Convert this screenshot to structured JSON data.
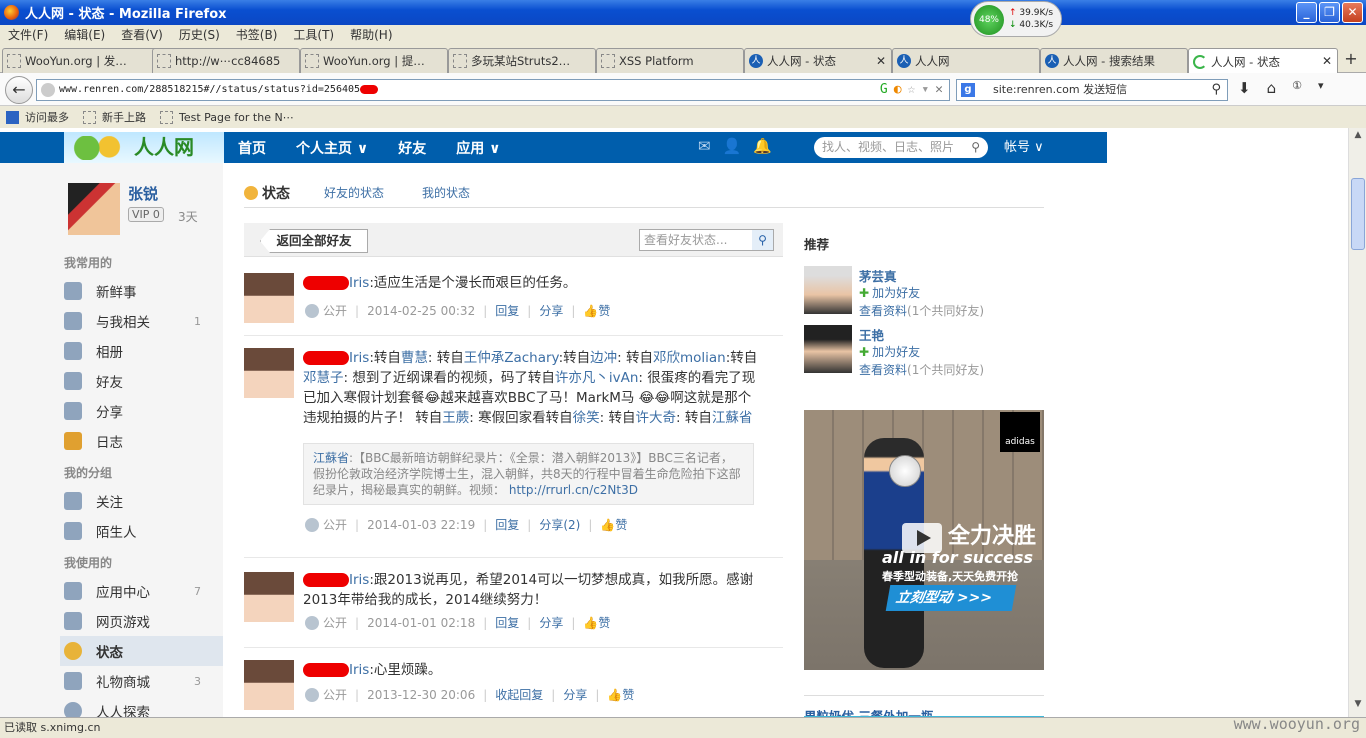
{
  "window": {
    "title": "人人网 - 状态 - Mozilla Firefox"
  },
  "netmon": {
    "percent": "48%",
    "up": "39.9K/s",
    "down": "40.3K/s"
  },
  "menu": [
    "文件(F)",
    "编辑(E)",
    "查看(V)",
    "历史(S)",
    "书签(B)",
    "工具(T)",
    "帮助(H)"
  ],
  "tabs": [
    {
      "label": "WooYun.org | 发…"
    },
    {
      "label": "http://w⋯cc84685"
    },
    {
      "label": "WooYun.org | 提…"
    },
    {
      "label": "多玩某站Struts2…"
    },
    {
      "label": "XSS Platform"
    },
    {
      "label": "人人网 - 状态"
    },
    {
      "label": "人人网"
    },
    {
      "label": "人人网 - 搜索结果"
    },
    {
      "label": "人人网 - 状态"
    }
  ],
  "url": "www.renren.com/288518215#//status/status?id=256405",
  "search": {
    "value": "site:renren.com 发送短信"
  },
  "bookmarks": [
    "访问最多",
    "新手上路",
    "Test Page for the N⋯"
  ],
  "site": {
    "logo": "人人网",
    "nav": [
      "首页",
      "个人主页 ∨",
      "好友",
      "应用 ∨"
    ],
    "search_placeholder": "找人、视频、日志、照片",
    "account": "帐号 ∨"
  },
  "profile": {
    "name": "张锐",
    "vip": "VIP 0",
    "days": "3天"
  },
  "left": {
    "common_title": "我常用的",
    "common": [
      {
        "label": "新鲜事",
        "count": ""
      },
      {
        "label": "与我相关",
        "count": "1"
      },
      {
        "label": "相册",
        "count": ""
      },
      {
        "label": "好友",
        "count": ""
      },
      {
        "label": "分享",
        "count": ""
      },
      {
        "label": "日志",
        "count": ""
      }
    ],
    "groups_title": "我的分组",
    "groups": [
      {
        "label": "关注"
      },
      {
        "label": "陌生人"
      }
    ],
    "used_title": "我使用的",
    "used": [
      {
        "label": "应用中心",
        "count": "7"
      },
      {
        "label": "网页游戏",
        "count": ""
      },
      {
        "label": "状态",
        "count": ""
      },
      {
        "label": "礼物商城",
        "count": "3"
      },
      {
        "label": "人人探索",
        "count": ""
      }
    ]
  },
  "main": {
    "tab_current": "状态",
    "tab_friends": "好友的状态",
    "tab_mine": "我的状态",
    "back_button": "返回全部好友",
    "feed_search_placeholder": "查看好友状态...",
    "public": "公开",
    "reply": "回复",
    "share": "分享",
    "like": "赞",
    "posts": [
      {
        "prefix": "Iris",
        "text": ":适应生活是个漫长而艰巨的任务。",
        "time": "2014-02-25 00:32"
      },
      {
        "prefix": "Iris",
        "text_a": ":转自",
        "l1": "曹慧",
        "text_b": ": 转自",
        "l2": "王仲承Zachary",
        "text_c": ":转自",
        "l3": "边冲",
        "text_d": ": 转自",
        "l4": "邓欣molian",
        "text_e": ":转自",
        "l5": "邓慧子",
        "text_f": ": 想到了近纲课看的视频，码了转自",
        "l6": "许亦凡丶ivAn",
        "text_g": ": 很蛋疼的看完了现已加入寒假计划套餐😂越来越喜欢BBC了马！MarkM马 😂😂啊这就是那个违规拍摄的片子！ 转自",
        "l7": "王蕨",
        "text_h": ": 寒假回家看转自",
        "l8": "徐笑",
        "text_i": ": 转自",
        "l9": "许大奇",
        "text_j": ": 转自",
        "l10": "江蘇省",
        "quote_src": "江蘇省",
        "quote_text": ":【BBC最新暗访朝鲜纪录片：《全景：潜入朝鲜2013》】BBC三名记者，假扮伦敦政治经济学院博士生，混入朝鲜，共8天的行程中冒着生命危险拍下这部纪录片，揭秘最真实的朝鲜。视频：",
        "quote_link": "http://rrurl.cn/c2Nt3D",
        "time": "2014-01-03 22:19",
        "share": "分享(2)"
      },
      {
        "prefix": "Iris",
        "text": ":跟2013说再见，希望2014可以一切梦想成真，如我所愿。感谢2013年带给我的成长，2014继续努力！",
        "time": "2014-01-01 02:18"
      },
      {
        "prefix": "Iris",
        "text": ":心里烦躁。",
        "time": "2013-12-30 20:06",
        "reply": "收起回复"
      }
    ]
  },
  "right": {
    "title": "推荐",
    "recs": [
      {
        "name": "茅芸真",
        "add": "加为好友",
        "view": "查看资料",
        "mutual": "(1个共同好友)"
      },
      {
        "name": "王艳",
        "add": "加为好友",
        "view": "查看资料",
        "mutual": "(1个共同好友)"
      }
    ],
    "ad": {
      "brand": "adidas",
      "big": "全力决胜",
      "eng": "all in for success",
      "sub": "春季型动装备,天天免费开抢",
      "cta": "立刻型动 >>>"
    },
    "ad2_title": "果粒奶优 三餐外加一瓶"
  },
  "status_bar": {
    "text": "已读取 s.xnimg.cn",
    "watermark": "www.wooyun.org"
  }
}
